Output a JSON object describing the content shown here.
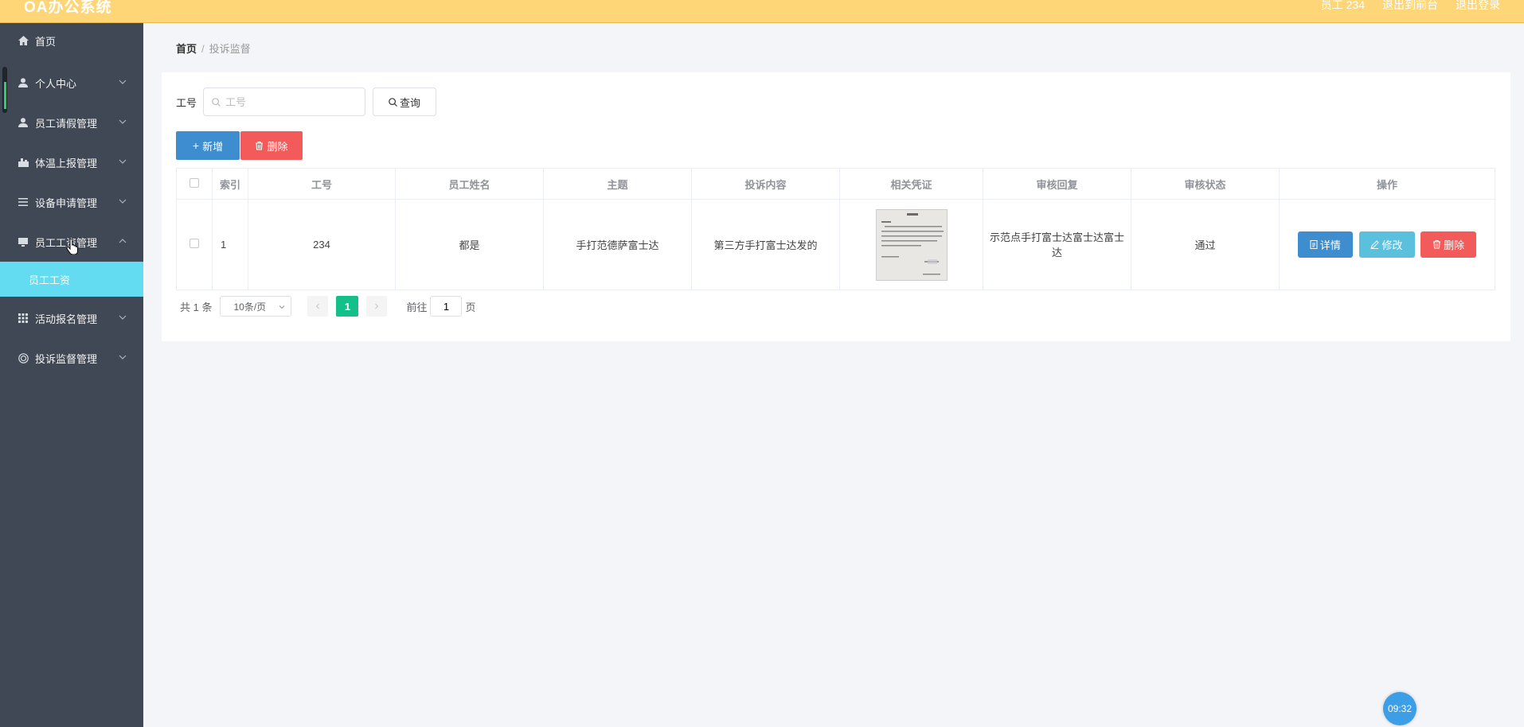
{
  "header": {
    "app_title": "OA办公系统",
    "user_label": "员工 234",
    "back_label": "退出到前台",
    "logout_label": "退出登录"
  },
  "sidebar": {
    "items": [
      {
        "label": "首页",
        "icon": "home-icon"
      },
      {
        "label": "个人中心",
        "icon": "user-icon"
      },
      {
        "label": "员工请假管理",
        "icon": "user-icon"
      },
      {
        "label": "体温上报管理",
        "icon": "thermometer-icon"
      },
      {
        "label": "设备申请管理",
        "icon": "list-icon"
      },
      {
        "label": "员工工资管理",
        "icon": "monitor-icon",
        "expanded": true
      },
      {
        "label": "活动报名管理",
        "icon": "grid-icon"
      },
      {
        "label": "投诉监督管理",
        "icon": "target-icon"
      }
    ],
    "submenu": {
      "label": "员工工资"
    }
  },
  "breadcrumb": {
    "home": "首页",
    "separator": "/",
    "current": "投诉监督"
  },
  "search": {
    "label": "工号",
    "placeholder": "工号",
    "button": "查询"
  },
  "actions": {
    "add": "新增",
    "delete": "删除"
  },
  "table": {
    "headers": [
      "索引",
      "工号",
      "员工姓名",
      "主题",
      "投诉内容",
      "相关凭证",
      "审核回复",
      "审核状态",
      "操作"
    ],
    "rows": [
      {
        "index": "1",
        "emp_no": "234",
        "name": "都是",
        "subject": "手打范德萨富士达",
        "content": "第三方手打富士达发的",
        "reply": "示范点手打富士达富士达富士达",
        "status": "通过"
      }
    ],
    "row_actions": {
      "detail": "详情",
      "edit": "修改",
      "delete": "删除"
    }
  },
  "pagination": {
    "total": "共 1 条",
    "page_size": "10条/页",
    "current_page": "1",
    "goto_label": "前往",
    "goto_value": "1",
    "page_unit": "页"
  },
  "clock": {
    "time": "09:32"
  },
  "colors": {
    "topbar": "#fed678",
    "sidebar": "#404855",
    "submenu_active": "#63dcf1",
    "primary": "#3e8ecf",
    "danger": "#f35b5a",
    "info": "#5bc0de",
    "page_active": "#13c08a"
  }
}
